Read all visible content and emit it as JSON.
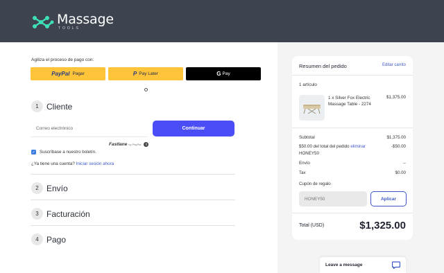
{
  "brand": {
    "name": "Massage",
    "sub": "TOOLS"
  },
  "express": {
    "label": "Agiliza el proceso de pago con:",
    "paypal": {
      "logo": "PayPal",
      "label": "Pagar"
    },
    "paylater": {
      "label": "Pay Later"
    },
    "gpay": {
      "label": "Pay"
    }
  },
  "steps": [
    {
      "num": "1",
      "title": "Cliente"
    },
    {
      "num": "2",
      "title": "Envío"
    },
    {
      "num": "3",
      "title": "Facturación"
    },
    {
      "num": "4",
      "title": "Pago"
    }
  ],
  "customer": {
    "email_placeholder": "Correo electrónico",
    "continue_label": "Continuar",
    "fastlane": "Fastlane",
    "fastlane_by": "by PayPal",
    "newsletter": "Suscríbase a nuestro boletín.",
    "account_question": "¿Ya tiene una cuenta?",
    "login_link": "Iniciar sesión ahora"
  },
  "summary": {
    "title": "Resumen del pedido",
    "edit_cart": "Editar carrito",
    "items_count": "1 artículo",
    "item": {
      "name": "1 x Silver Fox Electric Massage Table - 2274",
      "price": "$1,375.00"
    },
    "subtotal_label": "Subtotal",
    "subtotal_value": "$1,375.00",
    "discount_label": "$50.00 del total del pedido",
    "discount_link": "eliminar",
    "discount_value": "-$50.00",
    "discount_code": "HONEY50",
    "shipping_label": "Envío",
    "shipping_value": "--",
    "tax_label": "Tax",
    "tax_value": "$0.00",
    "coupon_label": "Cupón de regalo",
    "coupon_placeholder": "HONEY50",
    "apply_label": "Aplicar",
    "total_label": "Total (USD)",
    "total_value": "$1,325.00"
  },
  "chat": {
    "label": "Leave a message"
  },
  "colors": {
    "header": "#3d434f",
    "accent": "#4b4ef7",
    "link": "#3d56c9",
    "paypal_yellow": "#ffc439",
    "logo_teal": "#3ee0b8"
  }
}
